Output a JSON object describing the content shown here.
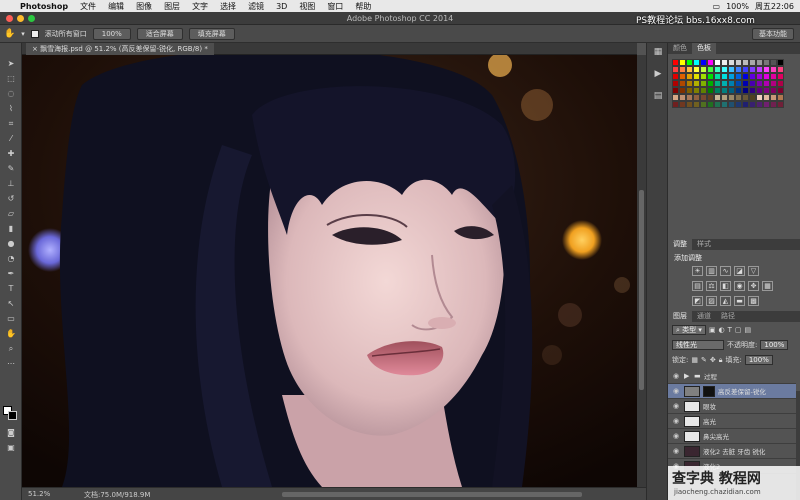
{
  "menubar": {
    "app": "Photoshop",
    "items": [
      "文件",
      "编辑",
      "图像",
      "图层",
      "文字",
      "选择",
      "滤镜",
      "3D",
      "视图",
      "窗口",
      "帮助"
    ],
    "battery": "100%",
    "clock": "周五22:06"
  },
  "window": {
    "title": "Adobe Photoshop CC 2014"
  },
  "options_bar": {
    "scroll_all_label": "滚动所有窗口",
    "zoom_100": "100%",
    "fit_screen": "适合屏幕",
    "fill_screen": "填充屏幕",
    "workspace": "基本功能"
  },
  "document": {
    "tab_title": "飘雪海报.psd @ 51.2% (高反差保留-锐化, RGB/8) *"
  },
  "status": {
    "zoom": "51.2%",
    "doc_size": "文档:75.0M/918.9M"
  },
  "panels": {
    "color_tab": "颜色",
    "swatches_tab": "色板",
    "adjust_tab": "调整",
    "styles_tab": "样式",
    "add_adjustment": "添加调整",
    "layers_tab": "图层",
    "channels_tab": "通道",
    "paths_tab": "路径",
    "kind_filter": "类型",
    "blend_mode": "线性光",
    "opacity_label": "不透明度:",
    "opacity_value": "100%",
    "lock_label": "锁定:",
    "fill_label": "填充:",
    "fill_value": "100%"
  },
  "layers": [
    {
      "name": "过程",
      "type": "group",
      "selected": false
    },
    {
      "name": "高反差保留-锐化",
      "type": "layer",
      "selected": true
    },
    {
      "name": "眼妆",
      "type": "layer",
      "selected": false
    },
    {
      "name": "高光",
      "type": "layer",
      "selected": false
    },
    {
      "name": "鼻尖高光",
      "type": "layer",
      "selected": false
    },
    {
      "name": "液化2 去脏 牙齿 锐化",
      "type": "layer",
      "selected": false
    },
    {
      "name": "液化2",
      "type": "layer",
      "selected": false
    }
  ],
  "watermarks": {
    "top": "PS教程论坛 bbs.16xx8.com",
    "bottom_big": "查字典 教程网",
    "bottom_small": "jiaocheng.chazidian.com"
  },
  "colors": {
    "traffic_red": "#fc5f57",
    "traffic_yellow": "#fdbb2d",
    "traffic_green": "#2bc840",
    "selected_layer": "#6b7ba0"
  }
}
